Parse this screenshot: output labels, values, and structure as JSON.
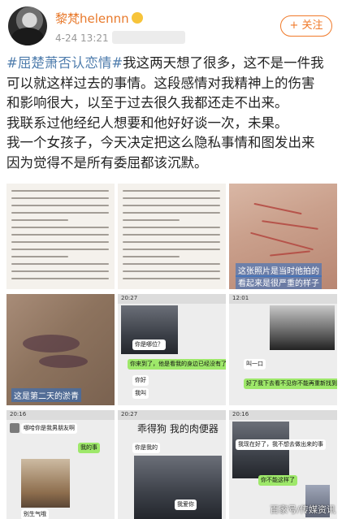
{
  "header": {
    "username": "黎梵helennn",
    "timestamp": "4-24 13:21",
    "follow_label": "+ 关注"
  },
  "post": {
    "hashtag": "#屈楚萧否认恋情#",
    "lines": [
      "我这两天想了很多，这不是一件我",
      "可以就这样过去的事情。这段感情对我精神上的伤害",
      "和影响很大，以至于过去很久我都还走不出来。",
      "我联系过他经纪人想要和他好好谈一次，未果。",
      "我一个女孩子，今天决定把这么隐私事情和图发出来",
      "因为觉得不是所有委屈都该沉默。"
    ]
  },
  "images": {
    "caption_back": "这张照片是当时他拍的",
    "caption_back2": "看起来是很严重的样子",
    "caption_bruise": "这是第二天的淤青",
    "chat1_msgs": [
      "你是哪位？",
      "你来到了，他是看我的身边已经没有了",
      "你好",
      "我叫"
    ],
    "chat2_msgs": [
      "叫一口",
      "好了我下去看不见你不能再重新找到的人"
    ],
    "chat4_msgs": [
      "哪哈你是我男朋友啊",
      "我的事"
    ],
    "chat4_tag": "别生气哦",
    "chat5_title": "乖得狗 我的肉便器",
    "chat5_msgs": [
      "你是我的",
      "我爱你"
    ],
    "chat6_msgs": [
      "我现在好了，我不想去做出来的事",
      "你不能这样了"
    ],
    "watermark": "百家号/传媒资讯"
  }
}
